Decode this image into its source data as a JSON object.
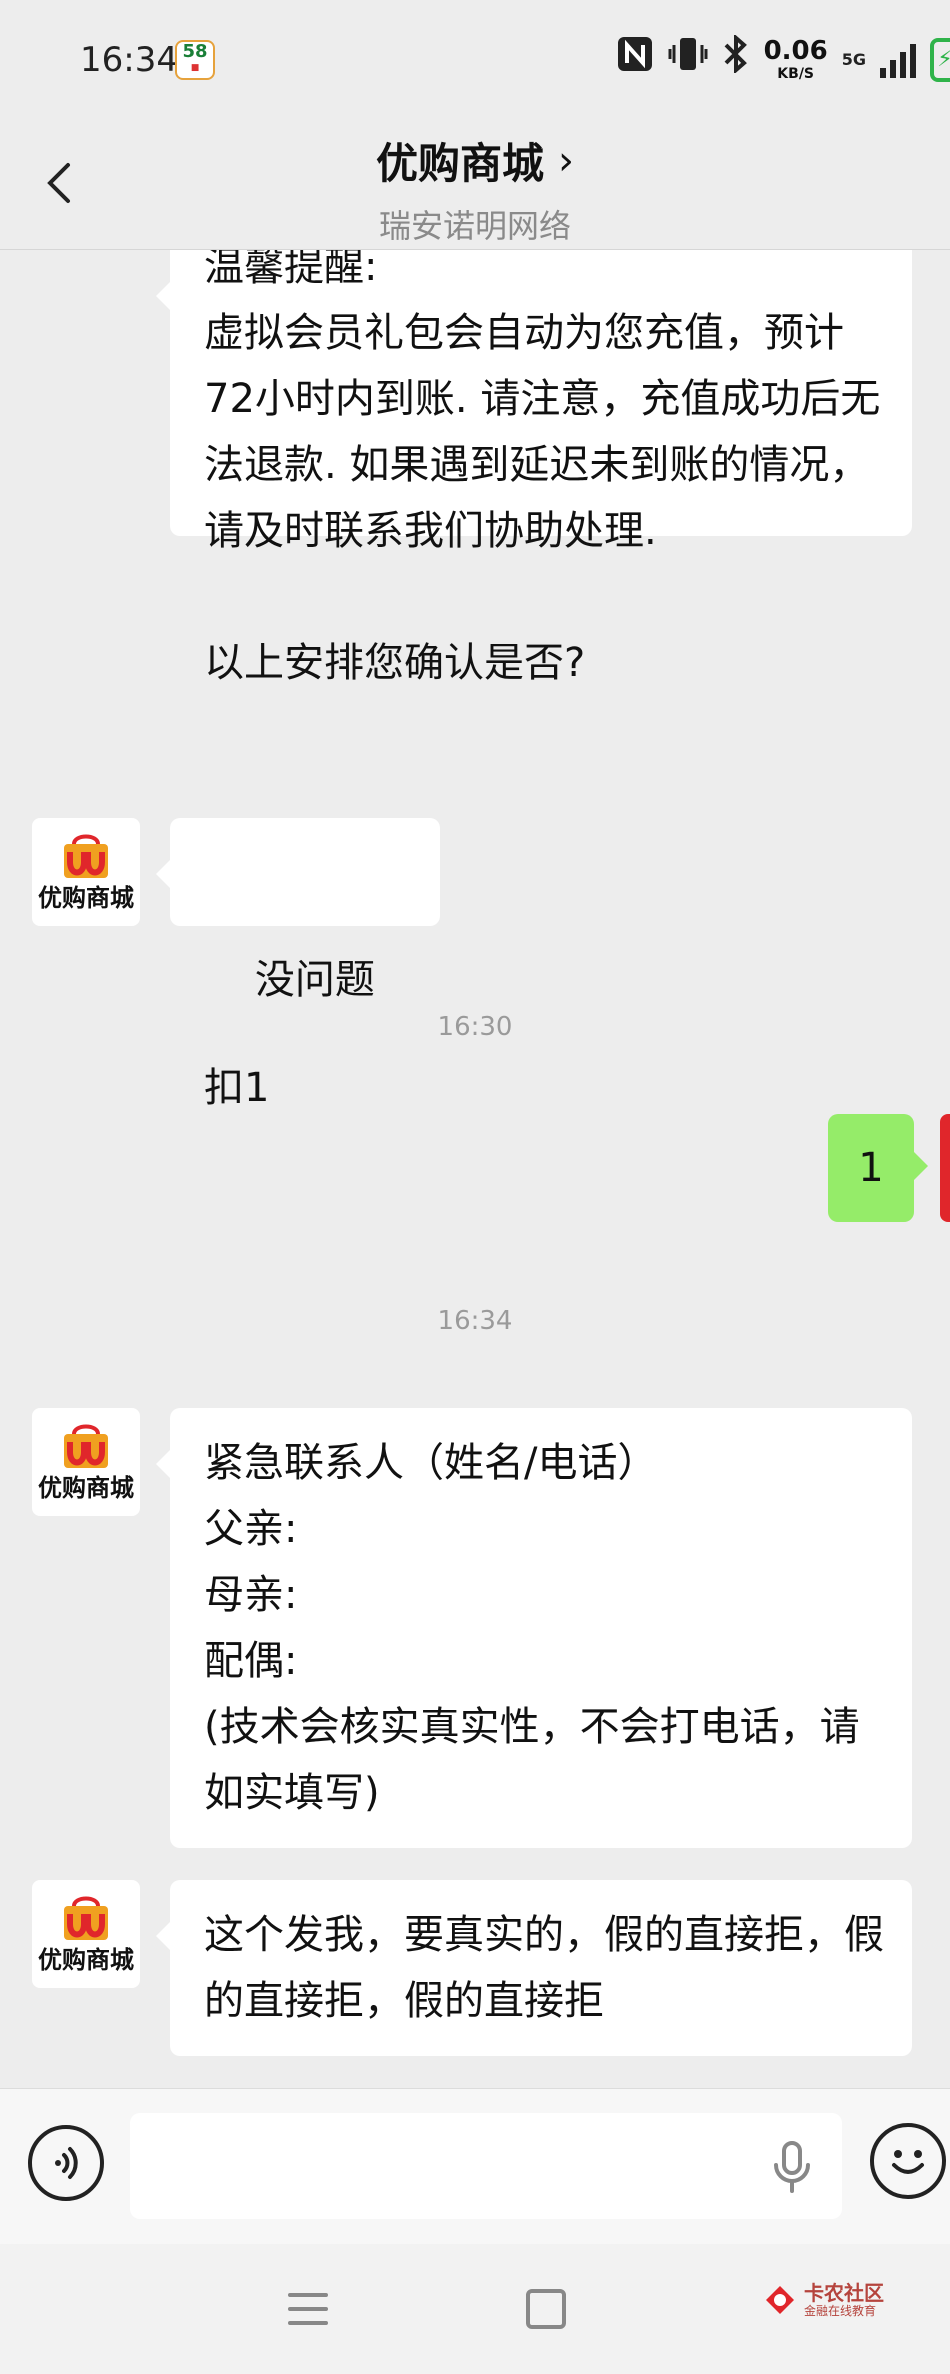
{
  "status_bar": {
    "time": "16:34",
    "badge_number": "58",
    "network_speed": "0.06",
    "network_unit": "KB/S",
    "network_type": "5G"
  },
  "header": {
    "title": "优购商城",
    "subtitle": "瑞安诺明网络"
  },
  "chat": {
    "contact_avatar_label": "优购商城",
    "messages": [
      {
        "from": "contact",
        "text": "温馨提醒:\n虚拟会员礼包会自动为您充值，预计72小时内到账. 请注意，充值成功后无法退款. 如果遇到延迟未到账的情况，请及时联系我们协助处理.\n\n以上安排您确认是否?"
      },
      {
        "from": "contact",
        "text": "没问题扣1"
      },
      {
        "type": "timestamp",
        "text": "16:30"
      },
      {
        "from": "self",
        "text": "1"
      },
      {
        "type": "timestamp",
        "text": "16:34"
      },
      {
        "from": "contact",
        "text": "紧急联系人（姓名/电话）\n父亲:\n母亲:\n配偶:\n(技术会核实真实性，不会打电话，请如实填写)"
      },
      {
        "from": "contact",
        "text": "这个发我，要真实的，假的直接拒，假的直接拒，假的直接拒"
      }
    ]
  },
  "input_bar": {
    "placeholder": "",
    "voice_icon": "voice-wave-icon",
    "mic_icon": "microphone-icon",
    "emoji_icon": "smiley-icon"
  },
  "watermark": {
    "text": "卡农社区",
    "sub": "金融在线教育"
  },
  "colors": {
    "background": "#ededed",
    "bubble_contact": "#ffffff",
    "bubble_self": "#95ec69",
    "battery": "#2fb34a",
    "brand_red": "#e0262b"
  }
}
